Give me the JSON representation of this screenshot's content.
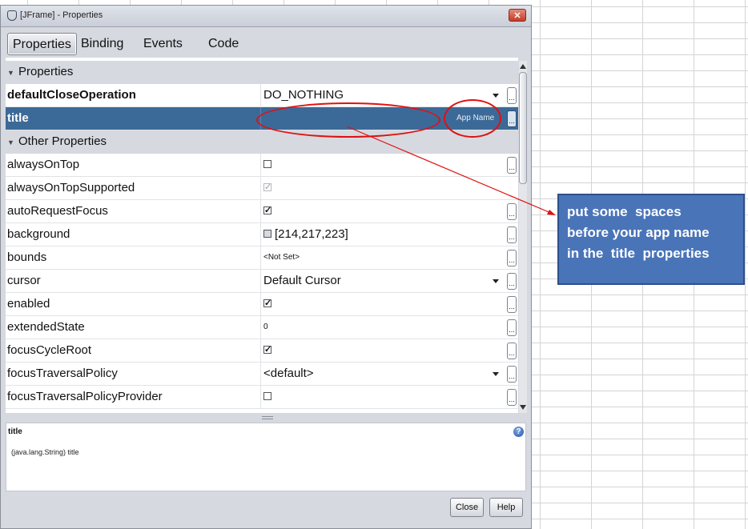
{
  "window": {
    "title": "[JFrame] - Properties",
    "close_glyph": "✕"
  },
  "tabs": [
    {
      "label": "Properties",
      "active": true
    },
    {
      "label": "Binding",
      "active": false
    },
    {
      "label": "Events",
      "active": false
    },
    {
      "label": "Code",
      "active": false
    }
  ],
  "categories": {
    "properties": "Properties",
    "other": "Other Properties"
  },
  "properties": {
    "defaultCloseOperation": {
      "name": "defaultCloseOperation",
      "value": "DO_NOTHING"
    },
    "title": {
      "name": "title",
      "value": "",
      "hint": "App Name"
    }
  },
  "other_properties": [
    {
      "name": "alwaysOnTop",
      "value": "",
      "checked": false
    },
    {
      "name": "alwaysOnTopSupported",
      "value": "",
      "checked": true
    },
    {
      "name": "autoRequestFocus",
      "value": "",
      "checked": true
    },
    {
      "name": "background",
      "value": "[214,217,223]"
    },
    {
      "name": "bounds",
      "value": "<Not Set>"
    },
    {
      "name": "cursor",
      "value": "Default Cursor"
    },
    {
      "name": "enabled",
      "value": "",
      "checked": true
    },
    {
      "name": "extendedState",
      "value": "0"
    },
    {
      "name": "focusCycleRoot",
      "value": "",
      "checked": true
    },
    {
      "name": "focusTraversalPolicy",
      "value": "<default>"
    },
    {
      "name": "focusTraversalPolicyProvider",
      "value": "",
      "checked": false
    }
  ],
  "ellipsis_label": "...",
  "check_glyph": "✓",
  "description": {
    "title": "title",
    "body": "(java.lang.String) title",
    "help_glyph": "?"
  },
  "buttons": {
    "close": "Close",
    "help": "Help"
  },
  "annotation": {
    "line1": "put some  spaces",
    "line2": "before your app name",
    "line3": "in the  title  properties"
  },
  "colors": {
    "selection": "#3c6a98",
    "annotation_red": "#e01010",
    "callout_blue": "#4a74b8"
  }
}
